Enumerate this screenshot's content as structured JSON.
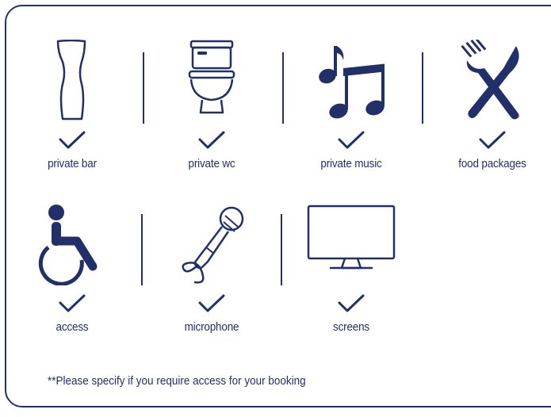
{
  "amenities_row1": [
    {
      "label": "private bar",
      "icon": "pint-glass-icon",
      "checked": true
    },
    {
      "label": "private wc",
      "icon": "toilet-icon",
      "checked": true
    },
    {
      "label": "private music",
      "icon": "music-notes-icon",
      "checked": true
    },
    {
      "label": "food packages",
      "icon": "fork-knife-icon",
      "checked": true
    }
  ],
  "amenities_row2": [
    {
      "label": "access",
      "icon": "wheelchair-icon",
      "checked": true
    },
    {
      "label": "microphone",
      "icon": "microphone-icon",
      "checked": true
    },
    {
      "label": "screens",
      "icon": "monitor-icon",
      "checked": true
    }
  ],
  "note": "**Please specify if you require access for your booking",
  "colors": {
    "primary": "#22306a",
    "background": "#ffffff"
  }
}
